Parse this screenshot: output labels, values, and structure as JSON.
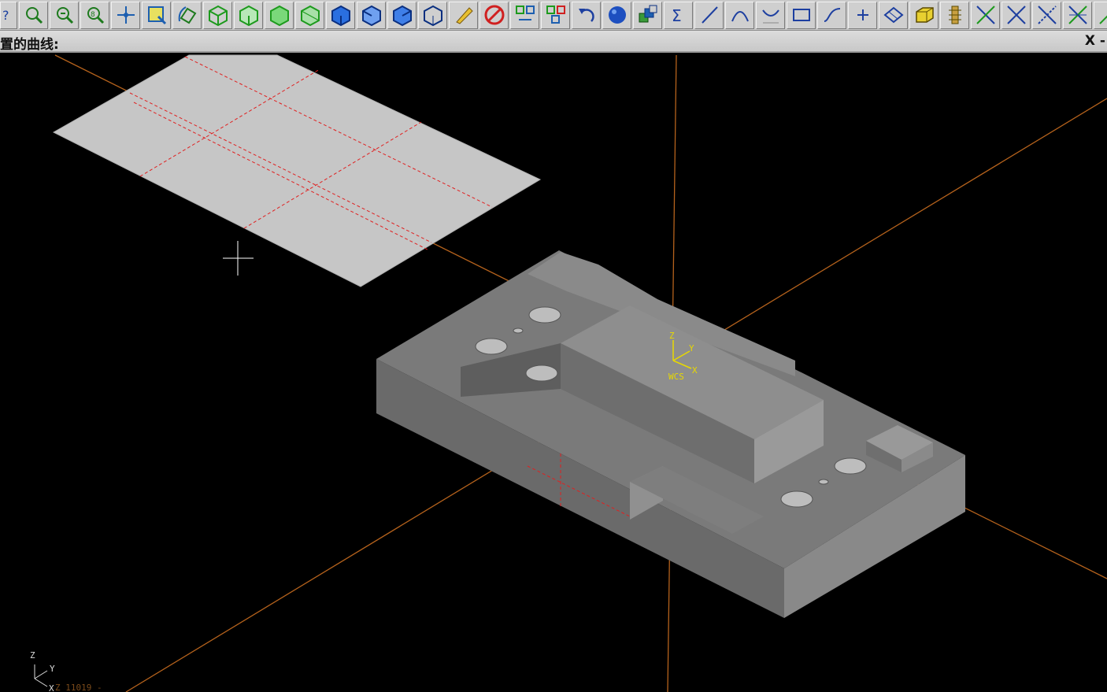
{
  "toolbar": {
    "buttons": [
      {
        "name": "help-icon"
      },
      {
        "name": "zoom-window-icon"
      },
      {
        "name": "zoom-in-icon"
      },
      {
        "name": "zoom-previous-icon"
      },
      {
        "name": "pan-icon"
      },
      {
        "name": "zoom-fit-icon"
      },
      {
        "name": "rotate-view-icon"
      },
      {
        "name": "view-top-icon"
      },
      {
        "name": "view-front-icon"
      },
      {
        "name": "view-side-icon"
      },
      {
        "name": "view-iso-icon"
      },
      {
        "name": "view-solid-blue-icon"
      },
      {
        "name": "view-solid-blue-2-icon"
      },
      {
        "name": "view-solid-blue-3-icon"
      },
      {
        "name": "view-wireframe-icon"
      },
      {
        "name": "pencil-icon"
      },
      {
        "name": "no-draw-icon"
      },
      {
        "name": "move-icon"
      },
      {
        "name": "copy-icon"
      },
      {
        "name": "undo-icon"
      },
      {
        "name": "shade-sphere-icon"
      },
      {
        "name": "layers-icon"
      },
      {
        "name": "sigma-icon"
      },
      {
        "name": "line-icon"
      },
      {
        "name": "arc-icon"
      },
      {
        "name": "fillet-icon"
      },
      {
        "name": "rectangle-icon"
      },
      {
        "name": "spline-icon"
      },
      {
        "name": "point-icon"
      },
      {
        "name": "surface-icon"
      },
      {
        "name": "solid-box-icon"
      },
      {
        "name": "tree-icon"
      },
      {
        "name": "trim-icon"
      },
      {
        "name": "trim-2-icon"
      },
      {
        "name": "trim-3-icon"
      },
      {
        "name": "trim-4-icon"
      },
      {
        "name": "extend-icon"
      }
    ]
  },
  "prompt": {
    "text": "置的曲线:",
    "coord_label": "X -"
  },
  "viewport": {
    "wcs_label": "WCS",
    "wcs_z": "Z",
    "wcs_y": "Y",
    "wcs_x": "X",
    "corner_z": "Z",
    "corner_y": "Y",
    "corner_x": "X",
    "status_readout": "Z   11019  -",
    "colors": {
      "background": "#000000",
      "axis_line": "#b5621c",
      "part_gray": "#808080",
      "surface_gray": "#c4c4c4",
      "red_guide": "#e02020",
      "wcs_yellow": "#e8d800"
    }
  }
}
